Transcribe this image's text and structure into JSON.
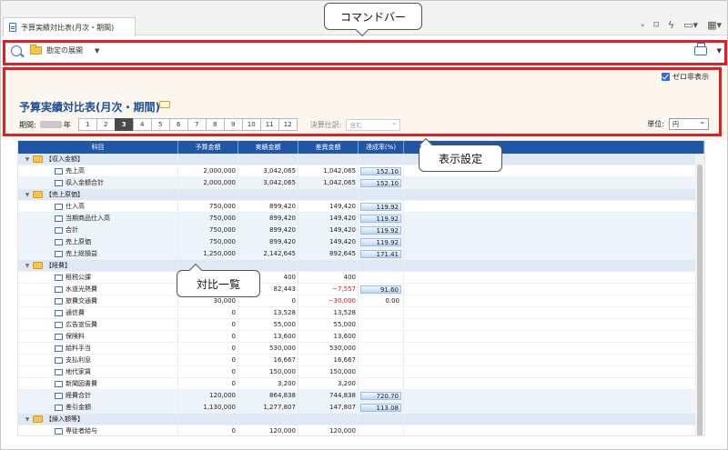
{
  "window": {
    "tab_title": "予算実績対比表(月次・期間)",
    "tools_more": "»"
  },
  "command_bar": {
    "expand_label": "勘定の展開",
    "search_icon": "search-icon",
    "print_icon": "printer-icon"
  },
  "settings": {
    "hide_zero_label": "ゼロ非表示",
    "title": "予算実績対比表(月次・期間)",
    "period_label": "期間:",
    "year_suffix": "年",
    "months": [
      "1",
      "2",
      "3",
      "4",
      "5",
      "6",
      "7",
      "8",
      "9",
      "10",
      "11",
      "12"
    ],
    "active_month": "3",
    "settle_label": "決算仕訳:",
    "settle_value": "含む",
    "unit_label": "単位:",
    "unit_value": "円"
  },
  "annotations": {
    "command_bar": "コマンドバー",
    "display_settings": "表示設定",
    "comparison_list": "対比一覧"
  },
  "table": {
    "headers": [
      "科目",
      "予算金額",
      "実績金額",
      "差異金額",
      "達成率(%)"
    ],
    "rows": [
      {
        "name": "【収入金額】",
        "type": "group",
        "budget": "",
        "actual": "",
        "diff": "",
        "rate": ""
      },
      {
        "name": "売上高",
        "type": "leaf",
        "budget": "2,000,000",
        "actual": "3,042,065",
        "diff": "1,042,065",
        "rate": "152.10"
      },
      {
        "name": "収入金額合計",
        "type": "sub",
        "budget": "2,000,000",
        "actual": "3,042,065",
        "diff": "1,042,065",
        "rate": "152.10"
      },
      {
        "name": "【売上原価】",
        "type": "group",
        "budget": "",
        "actual": "",
        "diff": "",
        "rate": ""
      },
      {
        "name": "仕入高",
        "type": "leaf",
        "budget": "750,000",
        "actual": "899,420",
        "diff": "149,420",
        "rate": "119.92"
      },
      {
        "name": "当期商品仕入高",
        "type": "sub",
        "budget": "750,000",
        "actual": "899,420",
        "diff": "149,420",
        "rate": "119.92"
      },
      {
        "name": "合計",
        "type": "sub",
        "budget": "750,000",
        "actual": "899,420",
        "diff": "149,420",
        "rate": "119.92"
      },
      {
        "name": "売上原価",
        "type": "sub",
        "budget": "750,000",
        "actual": "899,420",
        "diff": "149,420",
        "rate": "119.92"
      },
      {
        "name": "売上総損益",
        "type": "sub",
        "budget": "1,250,000",
        "actual": "2,142,645",
        "diff": "892,645",
        "rate": "171.41"
      },
      {
        "name": "【経費】",
        "type": "group",
        "budget": "",
        "actual": "",
        "diff": "",
        "rate": ""
      },
      {
        "name": "租税公課",
        "type": "leaf",
        "budget": "",
        "actual": "400",
        "diff": "400",
        "rate": ""
      },
      {
        "name": "水道光熱費",
        "type": "leaf",
        "budget": "",
        "actual": "82,443",
        "diff": "−7,557",
        "rate": "91.60",
        "neg": true
      },
      {
        "name": "旅費交通費",
        "type": "leaf",
        "budget": "30,000",
        "actual": "0",
        "diff": "−30,000",
        "rate": "0.00",
        "neg": true
      },
      {
        "name": "通信費",
        "type": "leaf",
        "budget": "0",
        "actual": "13,528",
        "diff": "13,528",
        "rate": ""
      },
      {
        "name": "広告宣伝費",
        "type": "leaf",
        "budget": "0",
        "actual": "55,000",
        "diff": "55,000",
        "rate": ""
      },
      {
        "name": "保険料",
        "type": "leaf",
        "budget": "0",
        "actual": "13,600",
        "diff": "13,600",
        "rate": ""
      },
      {
        "name": "給料手当",
        "type": "leaf",
        "budget": "0",
        "actual": "530,000",
        "diff": "530,000",
        "rate": ""
      },
      {
        "name": "支払利息",
        "type": "leaf",
        "budget": "0",
        "actual": "16,667",
        "diff": "16,667",
        "rate": ""
      },
      {
        "name": "地代家賃",
        "type": "leaf",
        "budget": "0",
        "actual": "150,000",
        "diff": "150,000",
        "rate": ""
      },
      {
        "name": "新聞図書費",
        "type": "leaf",
        "budget": "0",
        "actual": "3,200",
        "diff": "3,200",
        "rate": ""
      },
      {
        "name": "経費合計",
        "type": "sub",
        "budget": "120,000",
        "actual": "864,838",
        "diff": "744,838",
        "rate": "720.70"
      },
      {
        "name": "差引金額",
        "type": "sub",
        "budget": "1,130,000",
        "actual": "1,277,807",
        "diff": "147,807",
        "rate": "113.08"
      },
      {
        "name": "【繰入額等】",
        "type": "group",
        "budget": "",
        "actual": "",
        "diff": "",
        "rate": ""
      },
      {
        "name": "専従者給与",
        "type": "leaf",
        "budget": "0",
        "actual": "120,000",
        "diff": "120,000",
        "rate": ""
      }
    ]
  }
}
